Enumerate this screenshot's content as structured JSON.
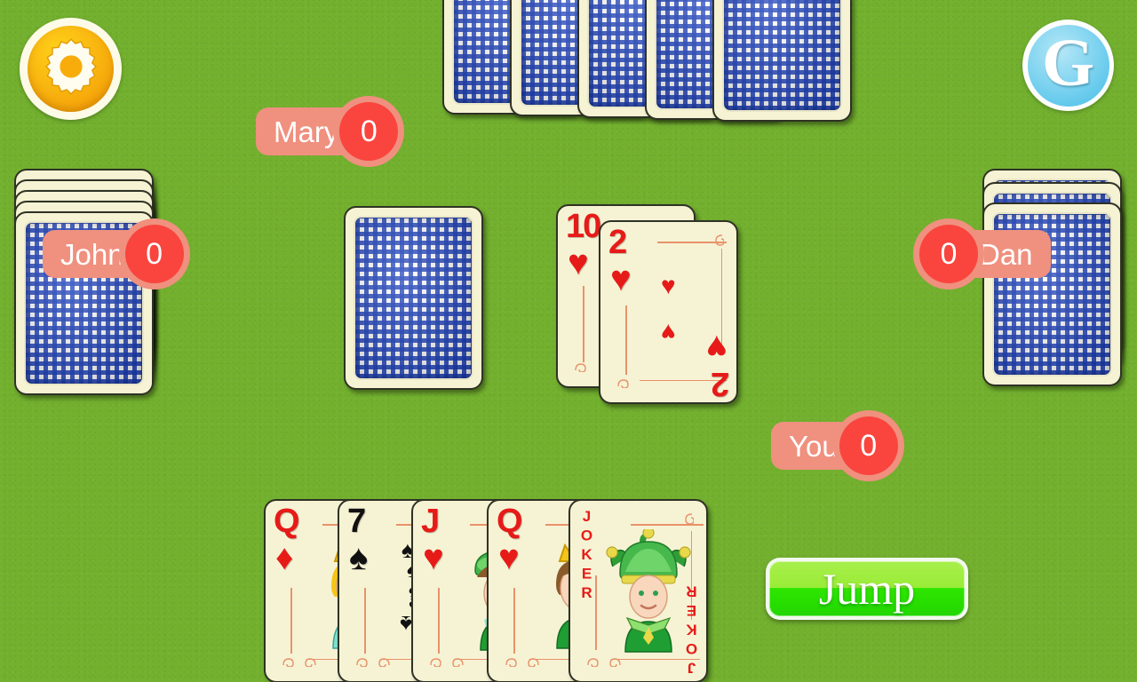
{
  "game": {
    "background_color": "#72b02e",
    "accent_red": "#f9453e",
    "accent_pill": "#f0907f",
    "card_face_color": "#f6f3d4",
    "card_back_color": "#1a3eba"
  },
  "toolbar": {
    "settings_icon": "gear-icon",
    "settings_label": "Settings",
    "logo_letter": "G",
    "logo_label": "Game Logo"
  },
  "players": [
    {
      "id": "mary",
      "name": "Mary",
      "score": "0",
      "position": "top",
      "hand_cards": 5,
      "layout": "name-then-score"
    },
    {
      "id": "john",
      "name": "John",
      "score": "0",
      "position": "left",
      "hand_cards": 5,
      "layout": "name-then-score"
    },
    {
      "id": "dan",
      "name": "Dan",
      "score": "0",
      "position": "right",
      "hand_cards": 3,
      "layout": "score-then-name"
    },
    {
      "id": "you",
      "name": "You",
      "score": "0",
      "position": "bottom",
      "hand_cards": 5,
      "layout": "name-then-score"
    }
  ],
  "table": {
    "draw_pile_label": "Draw Pile",
    "discard_pile_label": "Discard Pile",
    "discard_cards": [
      {
        "rank": "10",
        "suit": "hearts",
        "suit_glyph": "♥",
        "color": "red"
      },
      {
        "rank": "2",
        "suit": "hearts",
        "suit_glyph": "♥",
        "color": "red"
      }
    ]
  },
  "hand": {
    "label": "Your Hand",
    "cards": [
      {
        "rank": "Q",
        "suit": "diamonds",
        "suit_glyph": "♦",
        "color": "red",
        "kind": "court",
        "figure": "queen-blonde"
      },
      {
        "rank": "7",
        "suit": "spades",
        "suit_glyph": "♠",
        "color": "black",
        "kind": "pip",
        "pip_count": 7
      },
      {
        "rank": "J",
        "suit": "hearts",
        "suit_glyph": "♥",
        "color": "red",
        "kind": "court",
        "figure": "jack-green-cap"
      },
      {
        "rank": "Q",
        "suit": "hearts",
        "suit_glyph": "♥",
        "color": "red",
        "kind": "court",
        "figure": "queen-brunette"
      },
      {
        "rank": "JOKER",
        "suit": "joker",
        "suit_glyph": "",
        "color": "red",
        "kind": "joker",
        "figure": "jester-green"
      }
    ]
  },
  "actions": {
    "jump_label": "Jump"
  }
}
